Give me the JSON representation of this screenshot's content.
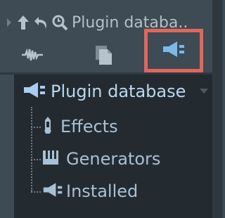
{
  "toolbar": {
    "title": "Plugin databa..",
    "icons": [
      "chevron-right-icon",
      "arrow-up-icon",
      "undo-icon",
      "search-icon"
    ]
  },
  "tabs": [
    {
      "icon": "waveform-icon",
      "active": false
    },
    {
      "icon": "document-icon",
      "active": false
    },
    {
      "icon": "plugin-icon",
      "active": true
    }
  ],
  "tree": {
    "root": {
      "label": "Plugin database",
      "icon": "plugin-icon",
      "expanded": true
    },
    "children": [
      {
        "label": "Effects",
        "icon": "effects-icon"
      },
      {
        "label": "Generators",
        "icon": "keyboard-icon"
      },
      {
        "label": "Installed",
        "icon": "plugin-icon"
      }
    ]
  },
  "colors": {
    "panel_bg": "#3e4a54",
    "tree_bg": "#232b31",
    "highlight_box": "#e0675a",
    "accent_icon": "#7cb9e8",
    "text": "#a9c0d4"
  }
}
